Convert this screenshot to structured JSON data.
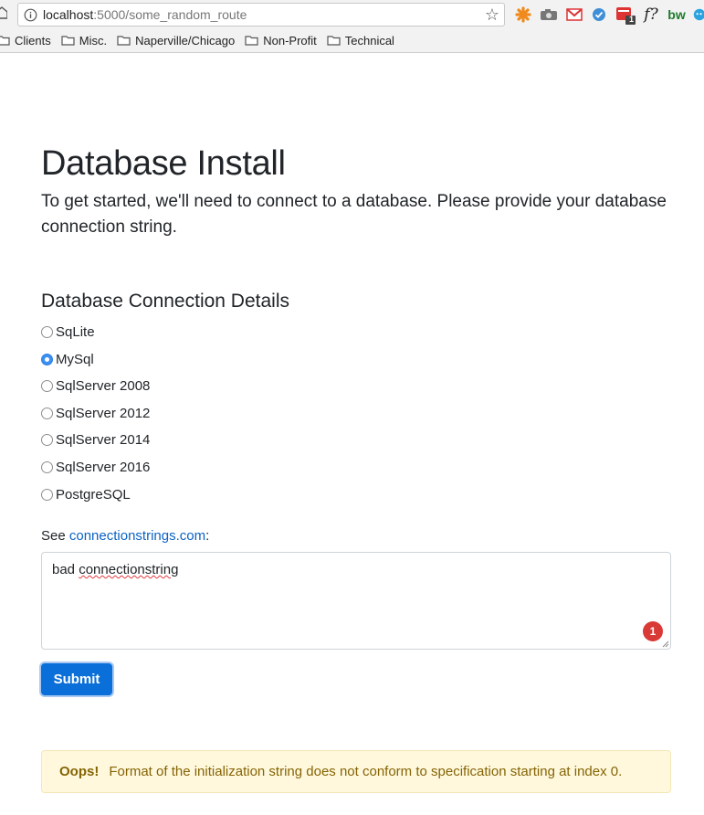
{
  "browser": {
    "url_host": "localhost",
    "url_path": ":5000/some_random_route",
    "extensions": [
      {
        "name": "orange-asterisk-extension-icon"
      },
      {
        "name": "camera-extension-icon"
      },
      {
        "name": "gmail-extension-icon"
      },
      {
        "name": "checkmark-extension-icon"
      },
      {
        "name": "calendar-extension-icon",
        "badge": "1"
      },
      {
        "name": "formula-extension-icon",
        "text": "f?"
      },
      {
        "name": "bw-extension-icon",
        "text": "bw"
      },
      {
        "name": "chat-extension-icon"
      }
    ],
    "bookmarks": [
      "Clients",
      "Misc.",
      "Naperville/Chicago",
      "Non-Profit",
      "Technical"
    ]
  },
  "page": {
    "title": "Database Install",
    "lead": "To get started, we'll need to connect to a database. Please provide your database connection string.",
    "section_title": "Database Connection Details",
    "providers": [
      {
        "label": "SqLite",
        "checked": false
      },
      {
        "label": "MySql",
        "checked": true
      },
      {
        "label": "SqlServer 2008",
        "checked": false
      },
      {
        "label": "SqlServer 2012",
        "checked": false
      },
      {
        "label": "SqlServer 2014",
        "checked": false
      },
      {
        "label": "SqlServer 2016",
        "checked": false
      },
      {
        "label": "PostgreSQL",
        "checked": false
      }
    ],
    "see_prefix": "See ",
    "see_link": "connectionstrings.com",
    "see_suffix": ":",
    "connection_value_word1": "bad ",
    "connection_value_word2": "connectionstring",
    "error_badge_count": "1",
    "submit_label": "Submit",
    "alert_strong": "Oops!",
    "alert_message": "Format of the initialization string does not conform to specification starting at index 0."
  },
  "colors": {
    "primary": "#0a6fd8",
    "link": "#0b63c5",
    "alert_bg": "#fff8dd",
    "alert_text": "#856404",
    "error_badge": "#d93a35"
  }
}
